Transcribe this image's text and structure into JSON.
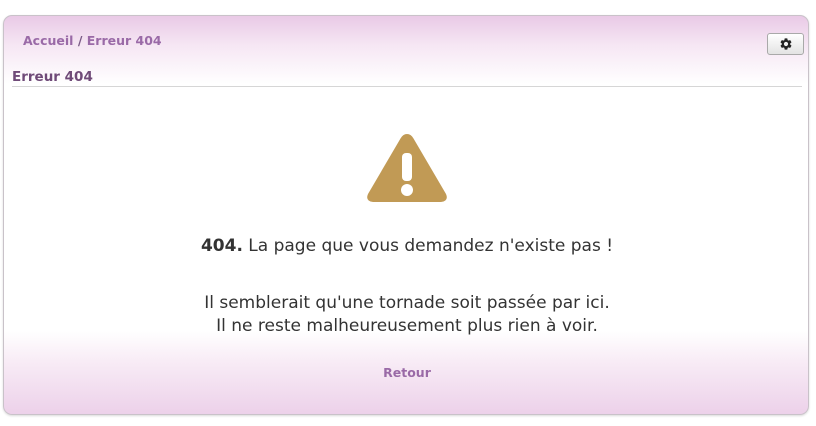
{
  "breadcrumb": {
    "home": "Accueil",
    "separator": "/",
    "current": "Erreur 404"
  },
  "toolbar": {
    "settings_icon": "gear-icon"
  },
  "page": {
    "title": "Erreur 404"
  },
  "error": {
    "icon": "warning-icon",
    "code": "404.",
    "message": " La page que vous demandez n'existe pas !",
    "line1": "Il semblerait qu'une tornade soit passée par ici.",
    "line2": "Il ne reste malheureusement plus rien à voir."
  },
  "actions": {
    "back_label": "Retour"
  },
  "colors": {
    "accent": "#9a6aa7",
    "title": "#6f4a78",
    "warning": "#c19a55"
  }
}
